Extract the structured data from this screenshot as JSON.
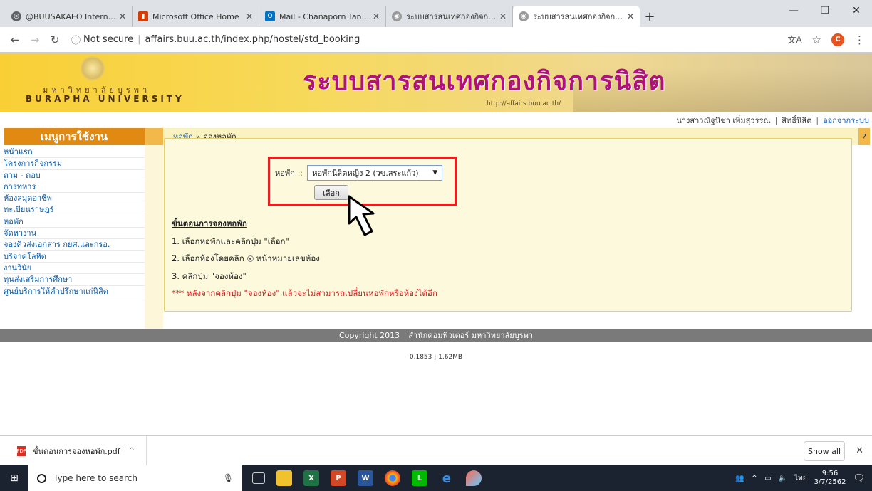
{
  "browser": {
    "tabs": [
      {
        "title": "@BUUSAKAEO Internet Authen",
        "icon_color": "#5f6368"
      },
      {
        "title": "Microsoft Office Home",
        "icon_color": "#d83b01"
      },
      {
        "title": "Mail - Chanaporn Tangmee - C",
        "icon_color": "#0072c6"
      },
      {
        "title": "ระบบสารสนเทศกองกิจการนิสิต มหา",
        "icon_color": "#9a9a9a"
      },
      {
        "title": "ระบบสารสนเทศกองกิจการนิสิต มหา",
        "icon_color": "#9a9a9a"
      }
    ],
    "new_tab": "+",
    "window_controls": [
      "—",
      "❐",
      "✕"
    ],
    "security_label": "Not secure",
    "url": "affairs.buu.ac.th/index.php/hostel/std_booking",
    "profile_initial": "C"
  },
  "banner": {
    "uni_thai": "มหาวิทยาลัยบูรพา",
    "uni_eng": "BURAPHA UNIVERSITY",
    "system_title": "ระบบสารสนเทศกองกิจการนิสิต",
    "system_url": "http://affairs.buu.ac.th/"
  },
  "userbar": {
    "name": "นางสาวณัฐนิชา เพิ่มสุวรรณ",
    "role": "สิทธิ์นิสิต",
    "logout": "ออกจากระบบ"
  },
  "menu": {
    "title": "เมนูการใช้งาน",
    "items": [
      "หน้าแรก",
      "โครงการกิจกรรม",
      "ถาม - ตอบ",
      "การทหาร",
      "ห้องสมุดอาชีพ",
      "ทะเบียนราษฎร์",
      "หอพัก",
      "จัดหางาน",
      "จองคิวส่งเอกสาร กยศ.และกรอ.",
      "บริจาคโลหิต",
      "งานวินัย",
      "ทุนส่งเสริมการศึกษา",
      "ศูนย์บริการให้คำปรึกษาแก่นิสิต"
    ]
  },
  "breadcrumb": {
    "parent": "หอพัก",
    "separator": "»",
    "current": "จองหอพัก"
  },
  "help": "?",
  "form": {
    "label": "หอพัก",
    "marker": "::",
    "selected": "หอพักนิสิตหญิง 2 (วข.สระแก้ว)",
    "button": "เลือก"
  },
  "steps": {
    "heading": "ขั้นตอนการจองหอพัก",
    "step1": "1. เลือกหอพักและคลิกปุ่ม \"เลือก\"",
    "step2_prefix": "2. เลือกห้องโดยคลิก",
    "step2_suffix": "หน้าหมายเลขห้อง",
    "step3": "3. คลิกปุ่ม \"จองห้อง\"",
    "warning": "*** หลังจากคลิกปุ่ม \"จองห้อง\" แล้วจะไม่สามารถเปลี่ยนหอพักหรือห้องได้อีก"
  },
  "footer": {
    "copyright": "Copyright 2013",
    "org": "สำนักคอมพิวเตอร์ มหาวิทยาลัยบูรพา",
    "stats": "0.1853 | 1.62MB"
  },
  "downloads": {
    "file": "ขั้นตอนการจองหอพัก.pdf",
    "show_all": "Show all"
  },
  "taskbar": {
    "search_placeholder": "Type here to search",
    "language": "ไทย",
    "time": "9:56",
    "date": "3/7/2562"
  },
  "colors": {
    "menu_header": "#e08a14",
    "title_magenta": "#b0117e",
    "highlight_red": "#e22121",
    "link_blue": "#1a5fb4"
  }
}
